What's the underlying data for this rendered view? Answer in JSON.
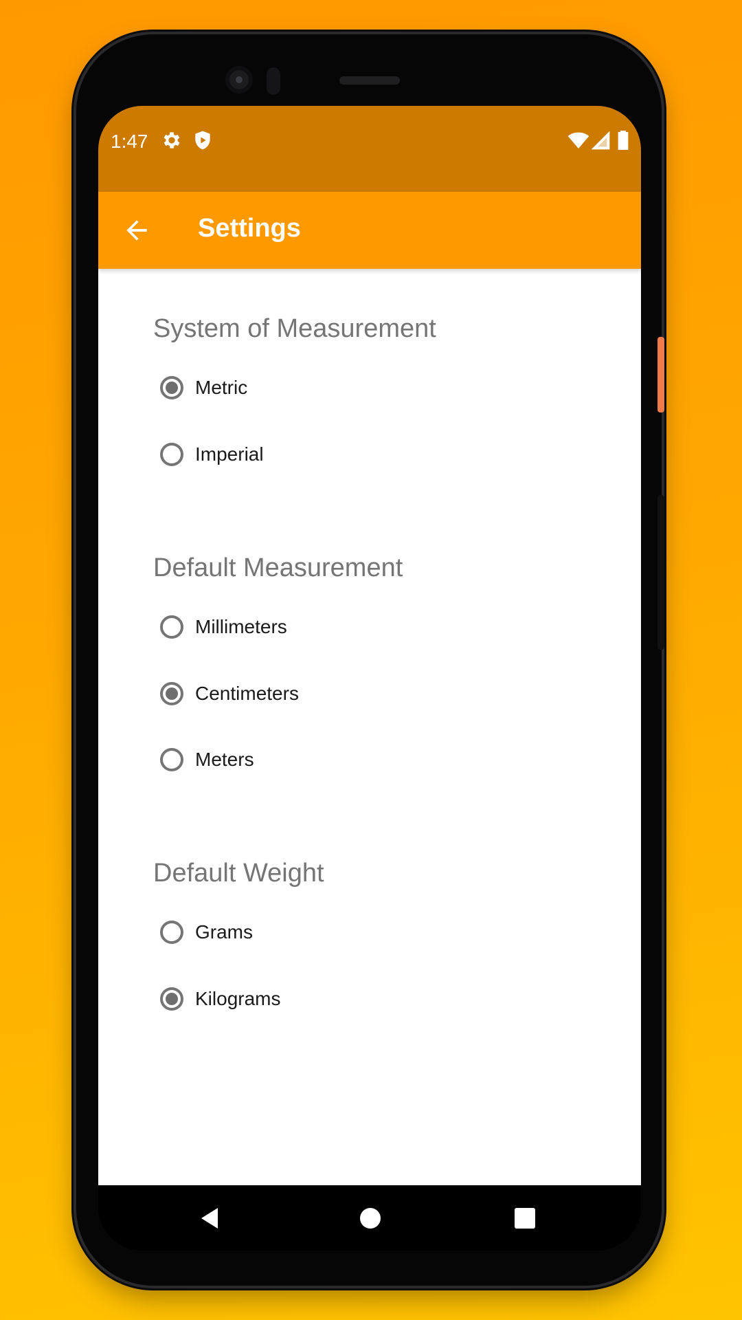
{
  "status_bar": {
    "time": "1:47",
    "left_icons": [
      "gear-icon",
      "shield-icon"
    ],
    "right_icons": [
      "wifi-icon",
      "signal-icon",
      "battery-icon"
    ],
    "color": "#cc7a00"
  },
  "app_bar": {
    "title": "Settings",
    "back_icon": "arrow-left-icon",
    "color": "#ff9900"
  },
  "sections": [
    {
      "title": "System of Measurement",
      "options": [
        {
          "label": "Metric",
          "selected": true
        },
        {
          "label": "Imperial",
          "selected": false
        }
      ]
    },
    {
      "title": "Default Measurement",
      "options": [
        {
          "label": "Millimeters",
          "selected": false
        },
        {
          "label": "Centimeters",
          "selected": true
        },
        {
          "label": "Meters",
          "selected": false
        }
      ]
    },
    {
      "title": "Default Weight",
      "options": [
        {
          "label": "Grams",
          "selected": false
        },
        {
          "label": "Kilograms",
          "selected": true
        }
      ]
    }
  ],
  "nav_bar": {
    "buttons": [
      "back-triangle-icon",
      "home-circle-icon",
      "recents-square-icon"
    ]
  }
}
